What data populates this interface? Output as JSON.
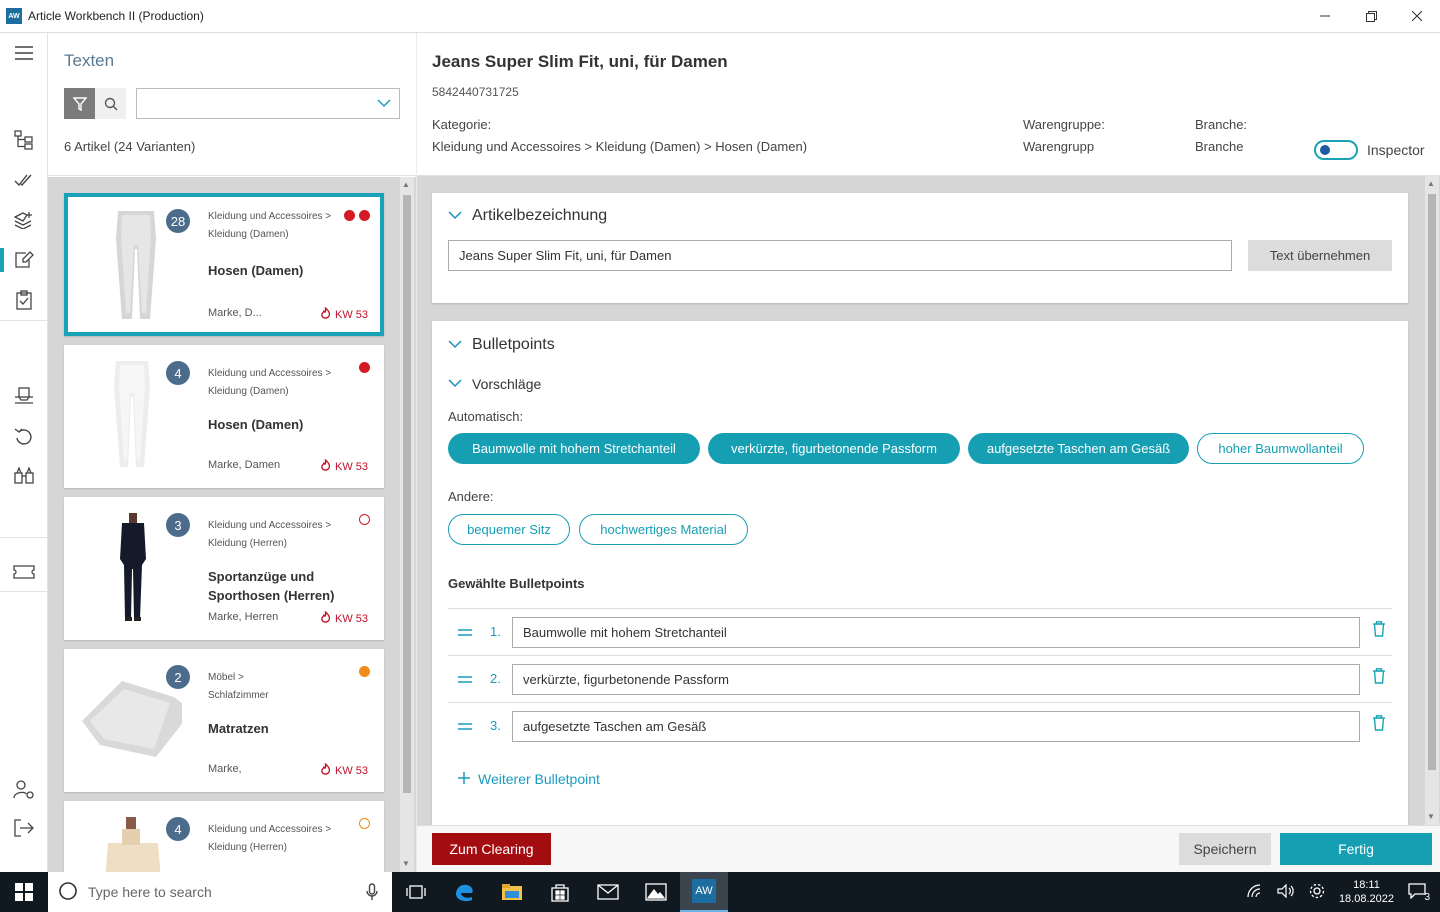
{
  "window": {
    "title": "Article Workbench II (Production)",
    "logo": "AW"
  },
  "list": {
    "section_title": "Texten",
    "count": "6 Artikel (24 Varianten)",
    "items": [
      {
        "badge": "28",
        "cat_line1": "Kleidung und Accessoires >",
        "cat_line2": "Kleidung (Damen)",
        "title": "Hosen (Damen)",
        "brand": "Marke, D...",
        "kw": "KW 53",
        "status": [
          "red",
          "red"
        ]
      },
      {
        "badge": "4",
        "cat_line1": "Kleidung und Accessoires >",
        "cat_line2": "Kleidung (Damen)",
        "title": "Hosen (Damen)",
        "brand": "Marke, Damen",
        "kw": "KW 53",
        "status": [
          "red"
        ]
      },
      {
        "badge": "3",
        "cat_line1": "Kleidung und Accessoires >",
        "cat_line2": "Kleidung (Herren)",
        "title": "Sportanzüge und Sporthosen (Herren)",
        "brand": "Marke, Herren",
        "kw": "KW 53",
        "status": [
          "ring-red"
        ]
      },
      {
        "badge": "2",
        "cat_line1": "Möbel >",
        "cat_line2": "Schlafzimmer",
        "title": "Matratzen",
        "brand": "Marke,",
        "kw": "KW 53",
        "status": [
          "orange"
        ]
      },
      {
        "badge": "4",
        "cat_line1": "Kleidung und Accessoires >",
        "cat_line2": "Kleidung (Herren)",
        "title": "",
        "brand": "",
        "kw": "",
        "status": [
          "ring-orange"
        ]
      }
    ]
  },
  "detail": {
    "title": "Jeans Super Slim Fit, uni, für Damen",
    "ean": "5842440731725",
    "kategorie_label": "Kategorie:",
    "kategorie_value": "Kleidung und Accessoires > Kleidung (Damen) > Hosen (Damen)",
    "warengruppe_label": "Warengruppe:",
    "warengruppe_value": "Warengrupp",
    "branche_label": "Branche:",
    "branche_value": "Branche",
    "inspector_label": "Inspector",
    "inspector_on": true
  },
  "artikelbezeichnung": {
    "title": "Artikelbezeichnung",
    "value": "Jeans Super Slim Fit, uni, für Damen",
    "button": "Text übernehmen"
  },
  "bulletpoints": {
    "title": "Bulletpoints",
    "vorschlaege": "Vorschläge",
    "auto_label": "Automatisch:",
    "auto_chips": [
      "Baumwolle mit hohem Stretchanteil",
      "verkürzte, figurbetonende Passform",
      "aufgesetzte Taschen am Gesäß",
      "hoher Baumwollanteil"
    ],
    "andere_label": "Andere:",
    "andere_chips": [
      "bequemer Sitz",
      "hochwertiges Material"
    ],
    "selected_label": "Gewählte Bulletpoints",
    "selected": [
      {
        "num": "1.",
        "text": "Baumwolle mit hohem Stretchanteil"
      },
      {
        "num": "2.",
        "text": "verkürzte, figurbetonende Passform"
      },
      {
        "num": "3.",
        "text": "aufgesetzte Taschen am Gesäß"
      }
    ],
    "add_label": "Weiterer Bulletpoint"
  },
  "footer": {
    "clearing": "Zum Clearing",
    "save": "Speichern",
    "done": "Fertig"
  },
  "taskbar": {
    "search_placeholder": "Type here to search",
    "time": "18:11",
    "date": "18.08.2022",
    "notifications": "3",
    "aw": "AW"
  },
  "colors": {
    "accent": "#169fb3",
    "danger": "#a30d12",
    "badge": "#4b6c8b"
  }
}
